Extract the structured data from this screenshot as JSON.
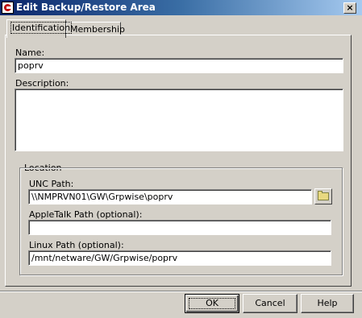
{
  "window": {
    "title": "Edit Backup/Restore Area",
    "close_symbol": "×"
  },
  "tabs": [
    {
      "label": "Identification",
      "active": true
    },
    {
      "label": "Membership",
      "active": false
    }
  ],
  "form": {
    "name_label": "Name:",
    "name_value": "poprv",
    "description_label": "Description:",
    "description_value": "",
    "location_group_label": "Location",
    "unc_label": "UNC Path:",
    "unc_value": "\\\\NMPRVN01\\GW\\Grpwise\\poprv",
    "appletalk_label": "AppleTalk Path (optional):",
    "appletalk_value": "",
    "linux_label": "Linux Path (optional):",
    "linux_value": "/mnt/netware/GW/Grpwise/poprv"
  },
  "buttons": {
    "ok": "OK",
    "cancel": "Cancel",
    "help": "Help"
  },
  "icons": {
    "app": "groupwise-app-icon",
    "browse": "folder-icon"
  }
}
